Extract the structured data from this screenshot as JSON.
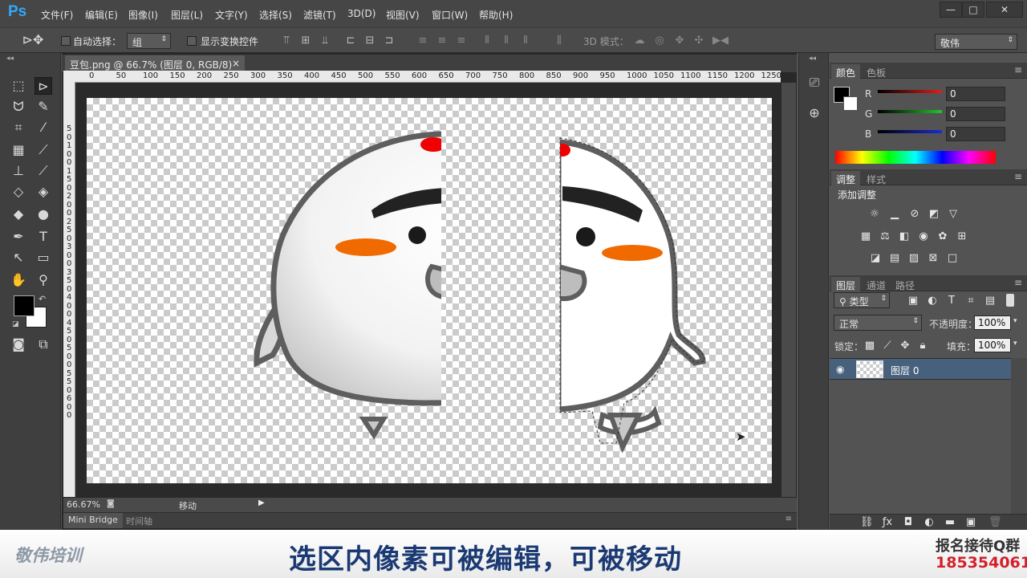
{
  "app": {
    "logo": "Ps"
  },
  "menu": [
    "文件(F)",
    "编辑(E)",
    "图像(I)",
    "图层(L)",
    "文字(Y)",
    "选择(S)",
    "滤镜(T)",
    "3D(D)",
    "视图(V)",
    "窗口(W)",
    "帮助(H)"
  ],
  "window_buttons": {
    "minimize": "—",
    "restore": "□",
    "close": "✕"
  },
  "options": {
    "auto_select_label": "自动选择：",
    "auto_select_value": "组",
    "show_transform_label": "显示变换控件",
    "mode_3d_label": "3D 模式：",
    "workspace": "敬伟"
  },
  "document": {
    "tab_title": "豆包.png @ 66.7% (图层 0, RGB/8) *",
    "zoom": "66.67%",
    "status_text": "移动"
  },
  "rulers": {
    "h_ticks": [
      "0",
      "50",
      "100",
      "150",
      "200",
      "250",
      "300",
      "350",
      "400",
      "450",
      "500",
      "550",
      "600",
      "650",
      "700",
      "750",
      "800",
      "850",
      "900",
      "950",
      "1000",
      "1050",
      "1100",
      "1150",
      "1200",
      "1250"
    ],
    "v_ticks": [
      "5",
      "0",
      "1",
      "0",
      "0",
      "1",
      "5",
      "0",
      "2",
      "0",
      "0",
      "2",
      "5",
      "0",
      "3",
      "0",
      "0",
      "3",
      "5",
      "0",
      "4",
      "0",
      "0",
      "4",
      "5",
      "0",
      "5",
      "0",
      "0",
      "5",
      "5",
      "0",
      "6",
      "0",
      "0"
    ]
  },
  "bottom_tabs": [
    "Mini Bridge",
    "时间轴"
  ],
  "color_panel": {
    "tabs": [
      "颜色",
      "色板"
    ],
    "channels": [
      {
        "label": "R",
        "value": "0",
        "color": "#e31d1d"
      },
      {
        "label": "G",
        "value": "0",
        "color": "#24c32b"
      },
      {
        "label": "B",
        "value": "0",
        "color": "#1a2bd6"
      }
    ]
  },
  "adjustments_panel": {
    "tabs": [
      "调整",
      "样式"
    ],
    "title": "添加调整"
  },
  "layers_panel": {
    "tabs": [
      "图层",
      "通道",
      "路径"
    ],
    "filter_label": "类型",
    "blend_mode": "正常",
    "opacity_label": "不透明度：",
    "opacity_value": "100%",
    "lock_label": "锁定：",
    "fill_label": "填充：",
    "fill_value": "100%",
    "layers": [
      {
        "name": "图层 0"
      }
    ]
  },
  "caption": {
    "brand": "敬伟培训",
    "main": "选区内像素可被编辑，可被移动",
    "contact_label": "报名接待Q群",
    "contact_number": "185354061"
  },
  "colors": {
    "accent": "#31a8ff",
    "caption_text": "#1b3a73",
    "contact_red": "#d3202a",
    "selected_layer": "#47617d"
  }
}
